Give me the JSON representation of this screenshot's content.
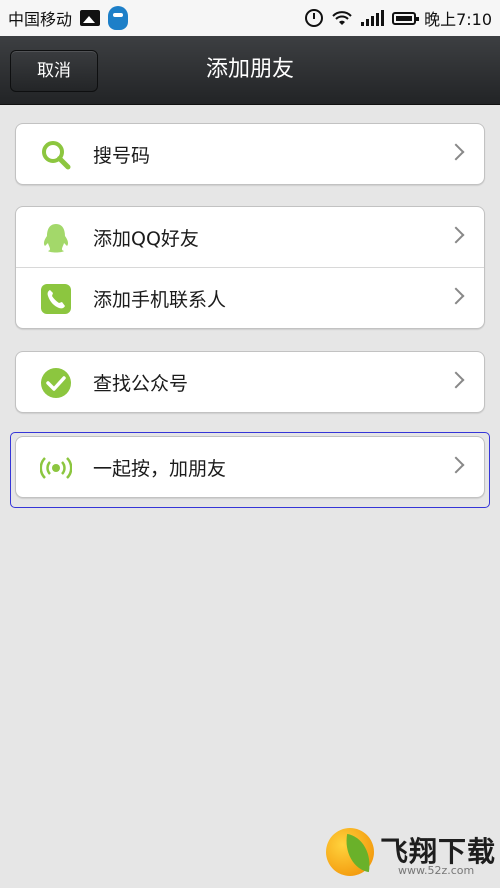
{
  "status_bar": {
    "carrier": "中国移动",
    "time": "晚上7:10"
  },
  "nav": {
    "cancel_label": "取消",
    "title": "添加朋友"
  },
  "groups": [
    {
      "items": [
        {
          "label": "搜号码",
          "icon": "search-icon"
        }
      ]
    },
    {
      "items": [
        {
          "label": "添加QQ好友",
          "icon": "qq-penguin-icon"
        },
        {
          "label": "添加手机联系人",
          "icon": "phone-icon"
        }
      ]
    },
    {
      "items": [
        {
          "label": "查找公众号",
          "icon": "checkmark-icon"
        }
      ]
    },
    {
      "items": [
        {
          "label": "一起按，加朋友",
          "icon": "radar-icon"
        }
      ]
    }
  ],
  "colors": {
    "accent_green": "#8cc63f",
    "nav_background": "#2d2f31",
    "page_background": "#e6e6e6",
    "selection_outline": "#3636d8"
  },
  "watermark": {
    "brand": "飞翔下载",
    "url": "www.52z.com"
  }
}
